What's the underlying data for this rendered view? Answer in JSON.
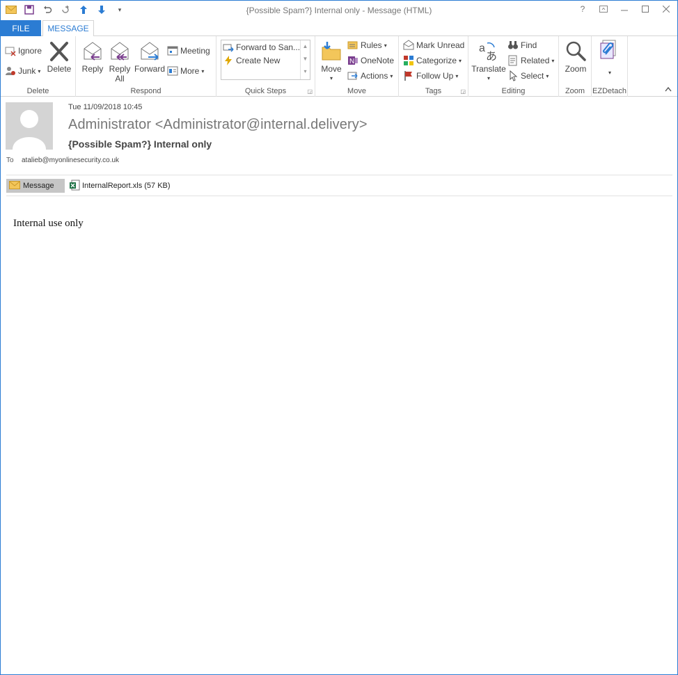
{
  "window": {
    "title": "{Possible Spam?} Internal only  - Message (HTML)"
  },
  "tabs": {
    "file": "FILE",
    "message": "MESSAGE"
  },
  "ribbon": {
    "delete_group": {
      "label": "Delete",
      "ignore": "Ignore",
      "junk": "Junk",
      "delete": "Delete"
    },
    "respond_group": {
      "label": "Respond",
      "reply": "Reply",
      "reply_all_1": "Reply",
      "reply_all_2": "All",
      "forward": "Forward",
      "meeting": "Meeting",
      "more": "More"
    },
    "quick_steps_group": {
      "label": "Quick Steps",
      "forward_to": "Forward to San...",
      "create_new": "Create New"
    },
    "move_group": {
      "label": "Move",
      "move": "Move",
      "rules": "Rules",
      "onenote": "OneNote",
      "actions": "Actions"
    },
    "tags_group": {
      "label": "Tags",
      "mark_unread": "Mark Unread",
      "categorize": "Categorize",
      "follow_up": "Follow Up"
    },
    "editing_group": {
      "label": "Editing",
      "translate": "Translate",
      "find": "Find",
      "related": "Related",
      "select": "Select"
    },
    "zoom_group": {
      "label": "Zoom",
      "zoom": "Zoom"
    },
    "ezdetach_group": {
      "label": "EZDetach"
    }
  },
  "message": {
    "date": "Tue 11/09/2018 10:45",
    "sender": "Administrator <Administrator@internal.delivery>",
    "subject": "{Possible Spam?} Internal only",
    "to_label": "To",
    "to_value": "atalieb@myonlinesecurity.co.uk",
    "attachments": {
      "message_tab": "Message",
      "file": "InternalReport.xls (57 KB)"
    },
    "body": "Internal use only"
  },
  "colors": {
    "accent": "#2b7cd3"
  }
}
